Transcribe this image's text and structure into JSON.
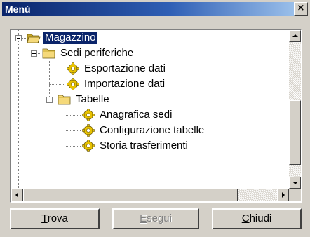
{
  "window": {
    "title": "Menù",
    "close_glyph": "×"
  },
  "tree": {
    "root": {
      "label": "Magazzino",
      "icon": "folder-open-icon",
      "expanded": true,
      "selected": true
    },
    "nodes": [
      {
        "id": "sedi",
        "label": "Sedi periferiche",
        "icon": "folder-icon",
        "expanded": true
      },
      {
        "id": "export",
        "label": "Esportazione dati",
        "icon": "gear-icon"
      },
      {
        "id": "import",
        "label": "Importazione dati",
        "icon": "gear-icon"
      },
      {
        "id": "tabelle",
        "label": "Tabelle",
        "icon": "folder-icon",
        "expanded": true
      },
      {
        "id": "anagrafica",
        "label": "Anagrafica sedi",
        "icon": "gear-icon"
      },
      {
        "id": "config",
        "label": "Configurazione tabelle",
        "icon": "gear-icon"
      },
      {
        "id": "storia",
        "label": "Storia trasferimenti",
        "icon": "gear-icon"
      }
    ]
  },
  "buttons": {
    "trova": {
      "mnemonic": "T",
      "rest": "rova",
      "enabled": true
    },
    "esegui": {
      "mnemonic": "E",
      "rest": "segui",
      "enabled": false
    },
    "chiudi": {
      "mnemonic": "C",
      "rest": "hiudi",
      "enabled": true
    }
  },
  "colors": {
    "selection": "#0a246a",
    "face": "#d4d0c8",
    "folder": "#f5d97a",
    "gear": "#e8c200"
  }
}
